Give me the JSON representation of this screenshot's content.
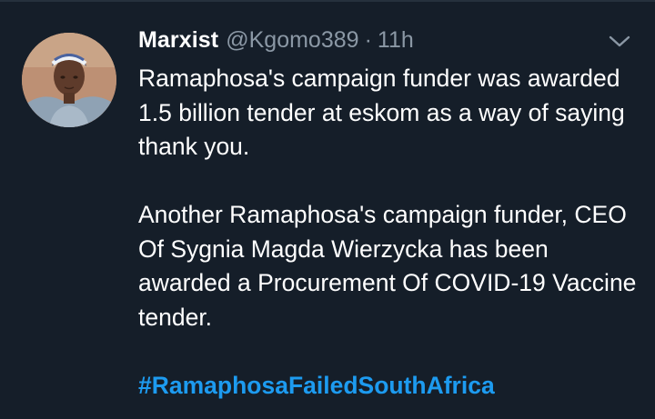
{
  "tweet": {
    "display_name": "Marxist",
    "handle": "@Kgomo389",
    "separator": "·",
    "time": "11h",
    "paragraphs": [
      "Ramaphosa's campaign funder was awarded 1.5 billion tender at eskom as a way of saying thank you.",
      "Another Ramaphosa's campaign funder, CEO Of Sygnia Magda Wierzycka has been awarded a Procurement Of COVID-19 Vaccine tender."
    ],
    "hashtag": "#RamaphosaFailedSouthAfrica"
  },
  "icons": {
    "menu": "chevron-down-icon",
    "avatar": "profile-photo"
  },
  "colors": {
    "background": "#151e29",
    "text": "#ffffff",
    "secondary_text": "#8b98a5",
    "link": "#1d9bf0"
  }
}
